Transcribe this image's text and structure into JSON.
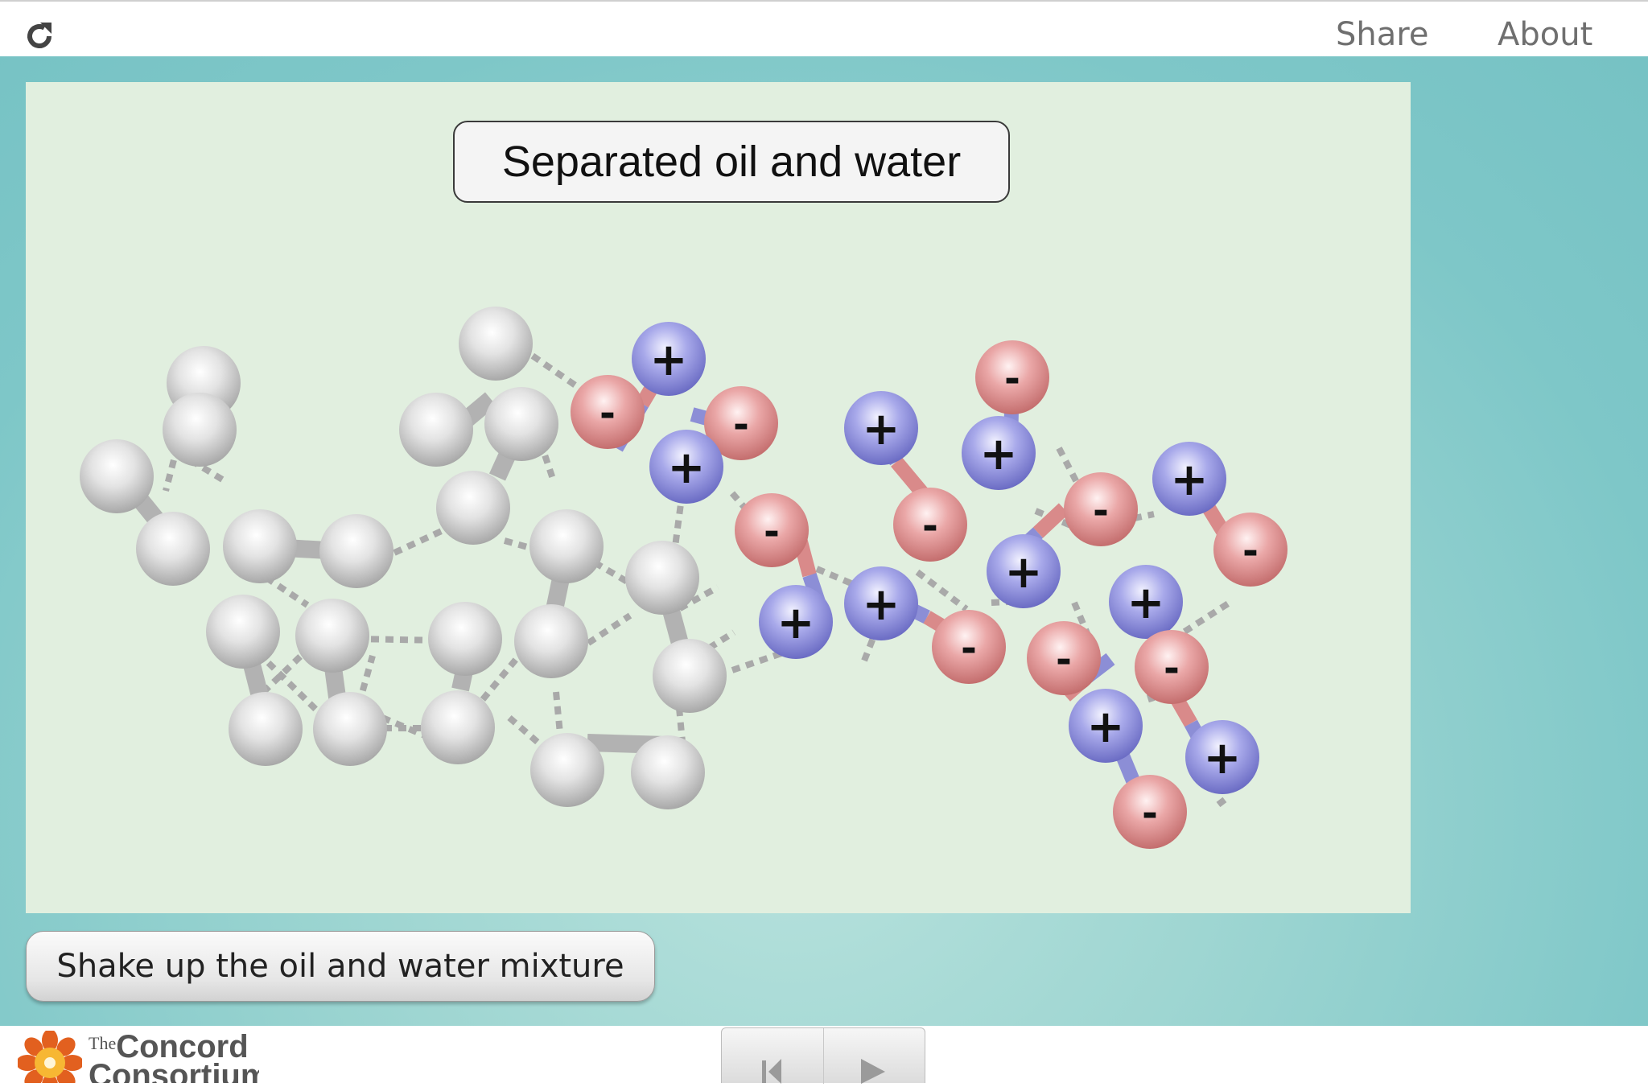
{
  "toolbar": {
    "reload_icon": "reload-icon",
    "share_label": "Share",
    "about_label": "About"
  },
  "model": {
    "title": "Separated oil and water",
    "background_color": "#e1efdf",
    "atom_colors": {
      "neutral": "#d9d9d9",
      "positive": "#9a9be0",
      "negative": "#e39a9a"
    },
    "positive_symbol": "+",
    "negative_symbol": "-"
  },
  "buttons": {
    "shake_label": "Shake up the oil and water mixture"
  },
  "footer": {
    "logo_small": "The",
    "logo_line1": "Concord",
    "logo_line2": "Consortium",
    "controls": [
      "reset-icon",
      "play-icon"
    ]
  }
}
